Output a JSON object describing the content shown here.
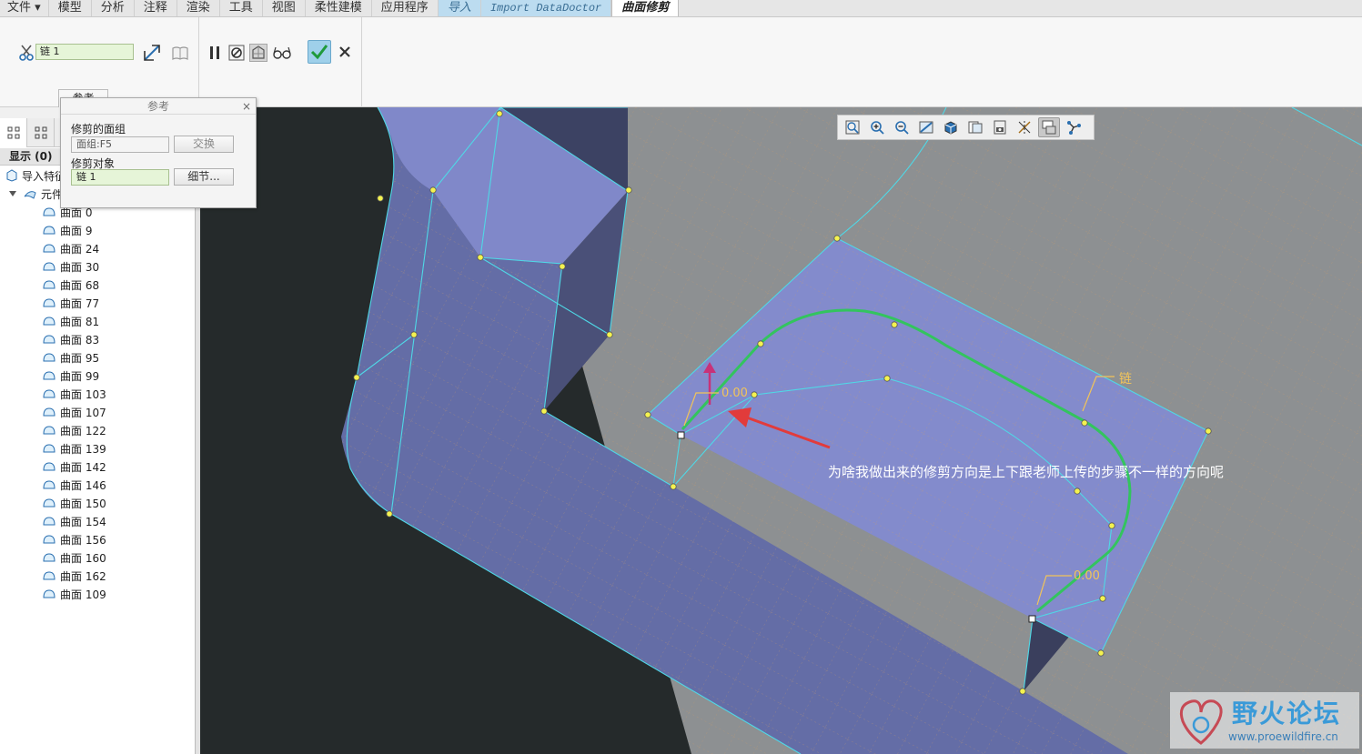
{
  "menu": {
    "file": "文件",
    "items": [
      "模型",
      "分析",
      "注释",
      "渲染",
      "工具",
      "视图",
      "柔性建模",
      "应用程序"
    ],
    "tab_import": "导入",
    "tab_datadoctor": "Import DataDoctor",
    "tab_active": "曲面修剪"
  },
  "dashboard": {
    "chain_field": "链 1",
    "ref_tab_label": "参考"
  },
  "ref_panel": {
    "title": "参考",
    "close": "×",
    "quilt_label": "修剪的面组",
    "quilt_value": "面组:F5",
    "swap_button": "交换",
    "trim_obj_label": "修剪对象",
    "trim_obj_value": "链 1",
    "details_button": "细节..."
  },
  "tree": {
    "show_label": "显示 (0)",
    "root_item": "导入特征",
    "group_item": "元件",
    "surfaces": [
      "曲面 0",
      "曲面 9",
      "曲面 24",
      "曲面 30",
      "曲面 68",
      "曲面 77",
      "曲面 81",
      "曲面 83",
      "曲面 95",
      "曲面 99",
      "曲面 103",
      "曲面 107",
      "曲面 122",
      "曲面 139",
      "曲面 142",
      "曲面 146",
      "曲面 150",
      "曲面 154",
      "曲面 156",
      "曲面 160",
      "曲面 162",
      "曲面 109"
    ]
  },
  "viewport": {
    "annotation": "为啥我做出来的修剪方向是上下跟老师上传的步骤不一样的方向呢",
    "dim1": "0.00",
    "dim2": "0.00",
    "chain_label": "链"
  },
  "watermark": {
    "title": "野火论坛",
    "url": "www.proewildfire.cn"
  },
  "colors": {
    "surface": "#7f88c8",
    "surface_dark": "#5d6597",
    "background_plane": "#8d9092",
    "chain": "#33c45e",
    "edge": "#4fd8e6",
    "vertex": "#f4f250",
    "accent_ok": "#9fd0ea"
  }
}
